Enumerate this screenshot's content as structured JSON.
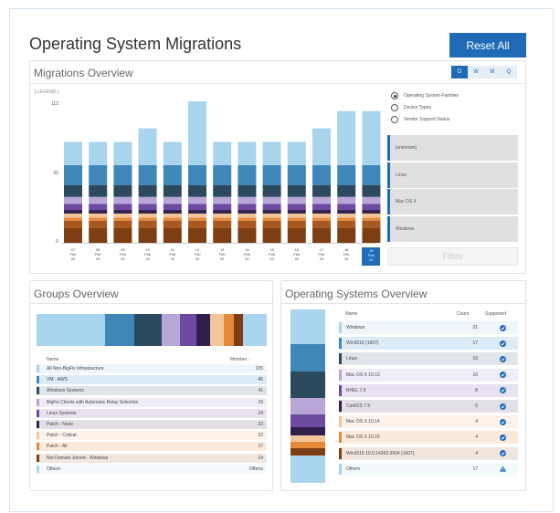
{
  "page": {
    "title": "Operating System Migrations",
    "reset_label": "Reset All"
  },
  "overview": {
    "title": "Migrations Overview",
    "legend_label": "[ LEGEND ]",
    "tabs": [
      {
        "label": "D",
        "active": true
      },
      {
        "label": "W",
        "active": false
      },
      {
        "label": "M",
        "active": false
      },
      {
        "label": "Q",
        "active": false
      }
    ],
    "y_ticks": [
      "112",
      "56",
      "0"
    ],
    "radio_options": [
      {
        "label": "Operating System Families",
        "selected": true
      },
      {
        "label": "Device Types",
        "selected": false
      },
      {
        "label": "Vendor Support Status",
        "selected": false
      }
    ],
    "families": [
      "[unknown]",
      "Linux",
      "Mac OS X",
      "Windows"
    ],
    "filter_label": "Filter"
  },
  "chart_data": {
    "type": "bar",
    "stacked": true,
    "categories": [
      "07 Feb 20",
      "08 Feb 20",
      "09 Feb 20",
      "10 Feb 20",
      "11 Feb 20",
      "12 Feb 20",
      "13 Feb 20",
      "14 Feb 20",
      "15 Feb 20",
      "16 Feb 20",
      "17 Feb 20",
      "18 Feb 20",
      "19 Feb 20"
    ],
    "selected_category": "19 Feb 20",
    "ylim": [
      0,
      112
    ],
    "y_ticks": [
      0,
      56,
      112
    ],
    "segment_colors": [
      "#7c3e12",
      "#a9581f",
      "#e58a3a",
      "#f2c69a",
      "#2f1f4a",
      "#6b4aa0",
      "#b8a6d9",
      "#2b4a5e",
      "#3f87b8",
      "#a8d4ee"
    ],
    "totals": [
      82,
      82,
      82,
      93,
      82,
      115,
      82,
      82,
      82,
      82,
      93,
      107,
      107
    ]
  },
  "groups": {
    "title": "Groups Overview",
    "col_name": "Name",
    "col_member": "Member ↓",
    "rows": [
      {
        "name": "All Non-BigFix Infrastructure",
        "value": "105",
        "color": "#a8d4ee",
        "bg": "#eef5fb"
      },
      {
        "name": "VM - AWS",
        "value": "45",
        "color": "#3f87b8",
        "bg": "#dcebf5"
      },
      {
        "name": "Windows Systems",
        "value": "41",
        "color": "#2b4a5e",
        "bg": "#dfe5e9"
      },
      {
        "name": "BigFix Clients with Automatic Relay Selection",
        "value": "29",
        "color": "#b8a6d9",
        "bg": "#f1edf8"
      },
      {
        "name": "Linux Systems",
        "value": "24",
        "color": "#6b4aa0",
        "bg": "#e8e2f1"
      },
      {
        "name": "Patch - None",
        "value": "23",
        "color": "#2f1f4a",
        "bg": "#e2e0e6"
      },
      {
        "name": "Patch - Critical",
        "value": "22",
        "color": "#f2c69a",
        "bg": "#fdf3ea"
      },
      {
        "name": "Patch - All",
        "value": "17",
        "color": "#e58a3a",
        "bg": "#fbeadb"
      },
      {
        "name": "Not Domain Joined - Windows",
        "value": "14",
        "color": "#7c3e12",
        "bg": "#f1e6dd"
      },
      {
        "name": "Others",
        "value": "Others",
        "color": "#a8d4ee",
        "bg": "#f4f9fc"
      }
    ],
    "strip_colors": [
      "#a8d4ee",
      "#3f87b8",
      "#2b4a5e",
      "#b8a6d9",
      "#6b4aa0",
      "#2f1f4a",
      "#f2c69a",
      "#e58a3a",
      "#7c3e12",
      "#a8d4ee"
    ]
  },
  "os": {
    "title": "Operating Systems Overview",
    "col_name": "Name",
    "col_count": "Count",
    "col_supported": "Supported",
    "rows": [
      {
        "name": "Windows",
        "count": "21",
        "status": "check",
        "color": "#a8d4ee",
        "bg": "#eef5fb"
      },
      {
        "name": "Win2016 (1607)",
        "count": "17",
        "status": "check",
        "color": "#3f87b8",
        "bg": "#dcebf5"
      },
      {
        "name": "Linux",
        "count": "16",
        "status": "check",
        "color": "#2b4a5e",
        "bg": "#dfe5e9"
      },
      {
        "name": "Mac OS X 10.13",
        "count": "10",
        "status": "check",
        "color": "#b8a6d9",
        "bg": "#f1edf8"
      },
      {
        "name": "RHEL 7.6",
        "count": "8",
        "status": "check",
        "color": "#6b4aa0",
        "bg": "#e8e2f1"
      },
      {
        "name": "CentOS 7.5",
        "count": "5",
        "status": "check",
        "color": "#2f1f4a",
        "bg": "#e2e0e6"
      },
      {
        "name": "Mac OS X 10.14",
        "count": "4",
        "status": "check",
        "color": "#f2c69a",
        "bg": "#fdf3ea"
      },
      {
        "name": "Mac OS X 10.15",
        "count": "4",
        "status": "check",
        "color": "#e58a3a",
        "bg": "#fbeadb"
      },
      {
        "name": "Win2016 10.0.14393.3504 (1607)",
        "count": "4",
        "status": "check",
        "color": "#7c3e12",
        "bg": "#f1e6dd"
      },
      {
        "name": "Others",
        "count": "17",
        "status": "warning",
        "color": "#a8d4ee",
        "bg": "#f4f9fc"
      }
    ],
    "strip_colors": [
      "#a8d4ee",
      "#3f87b8",
      "#2b4a5e",
      "#b8a6d9",
      "#6b4aa0",
      "#2f1f4a",
      "#f2c69a",
      "#e58a3a",
      "#7c3e12",
      "#a8d4ee"
    ],
    "strip_weights": [
      21,
      17,
      16,
      10,
      8,
      5,
      4,
      4,
      4,
      17
    ]
  }
}
